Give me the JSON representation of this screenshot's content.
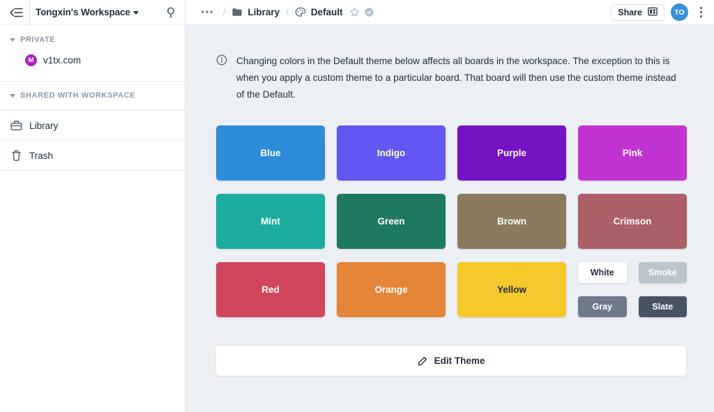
{
  "sidebar": {
    "workspace_name": "Tongxin's Workspace",
    "hamburger_icon": "collapse-sidebar-icon",
    "pin_icon": "pin-icon",
    "private": {
      "label": "PRIVATE",
      "items": [
        {
          "label": "v1tx.com",
          "badge": "M",
          "badge_color": "#b01fc4"
        }
      ]
    },
    "shared": {
      "label": "SHARED WITH WORKSPACE"
    },
    "nav": [
      {
        "label": "Library",
        "icon": "briefcase-icon"
      },
      {
        "label": "Trash",
        "icon": "trash-icon"
      }
    ]
  },
  "topbar": {
    "overflow": "•••",
    "separator": "/",
    "breadcrumbs": [
      {
        "label": "Library",
        "icon": "folder-icon"
      },
      {
        "label": "Default",
        "icon": "palette-icon"
      }
    ],
    "star_icon": "star-outline-icon",
    "check_icon": "check-circle-icon",
    "share_label": "Share",
    "share_icon": "share-board-icon",
    "avatar_initials": "TO",
    "avatar_color": "#3b8fd8",
    "menu_icon": "more-vertical-icon"
  },
  "notice": {
    "icon": "info-icon",
    "text": "Changing colors in the Default theme below affects all boards in the workspace. The exception to this is when you apply a custom theme to a particular board. That board will then use the custom theme instead of the Default."
  },
  "swatches": {
    "row1": [
      {
        "label": "Blue",
        "color": "#2d8cd8",
        "text": "light"
      },
      {
        "label": "Indigo",
        "color": "#6257f0",
        "text": "light"
      },
      {
        "label": "Purple",
        "color": "#7412c4",
        "text": "light"
      },
      {
        "label": "Pink",
        "color": "#c234d2",
        "text": "light"
      }
    ],
    "row2": [
      {
        "label": "Mint",
        "color": "#1bae9e",
        "text": "light"
      },
      {
        "label": "Green",
        "color": "#1e7862",
        "text": "light"
      },
      {
        "label": "Brown",
        "color": "#8a7a5e",
        "text": "light"
      },
      {
        "label": "Crimson",
        "color": "#ac5f66",
        "text": "light"
      }
    ],
    "row3": [
      {
        "label": "Red",
        "color": "#d1455c",
        "text": "light"
      },
      {
        "label": "Orange",
        "color": "#e58538",
        "text": "light"
      },
      {
        "label": "Yellow",
        "color": "#f7c82c",
        "text": "dark"
      }
    ],
    "mini": [
      {
        "label": "White",
        "color": "#ffffff",
        "text": "dark"
      },
      {
        "label": "Smoke",
        "color": "#bac5ce",
        "text": "light"
      },
      {
        "label": "Gray",
        "color": "#6c7a89",
        "text": "light"
      },
      {
        "label": "Slate",
        "color": "#455460",
        "text": "light"
      }
    ]
  },
  "edit_theme": {
    "label": "Edit Theme",
    "icon": "pencil-icon"
  }
}
